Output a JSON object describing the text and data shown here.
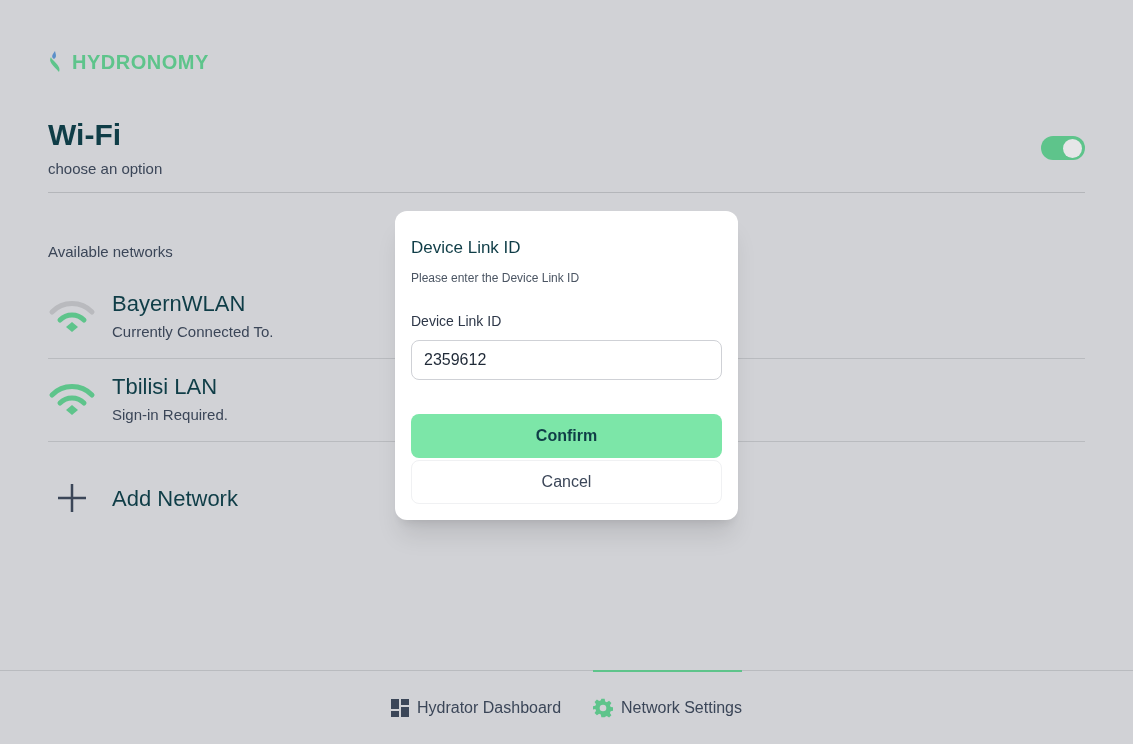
{
  "brand": "HYDRONOMY",
  "header": {
    "title": "Wi-Fi",
    "subtitle": "choose an option",
    "wifi_on": true
  },
  "section_label": "Available networks",
  "networks": [
    {
      "name": "BayernWLAN",
      "status": "Currently Connected To.",
      "kind": "partial"
    },
    {
      "name": "Tbilisi LAN",
      "status": "Sign-in Required.",
      "kind": "full"
    }
  ],
  "add_network": "Add Network",
  "dialog": {
    "title": "Device Link ID",
    "subtitle": "Please enter the Device Link ID",
    "field_label": "Device Link ID",
    "field_value": "2359612",
    "confirm": "Confirm",
    "cancel": "Cancel"
  },
  "tabs": [
    {
      "label": "Hydrator Dashboard",
      "kind": "dashboard",
      "selected": false
    },
    {
      "label": "Network Settings",
      "kind": "settings",
      "selected": true
    }
  ]
}
